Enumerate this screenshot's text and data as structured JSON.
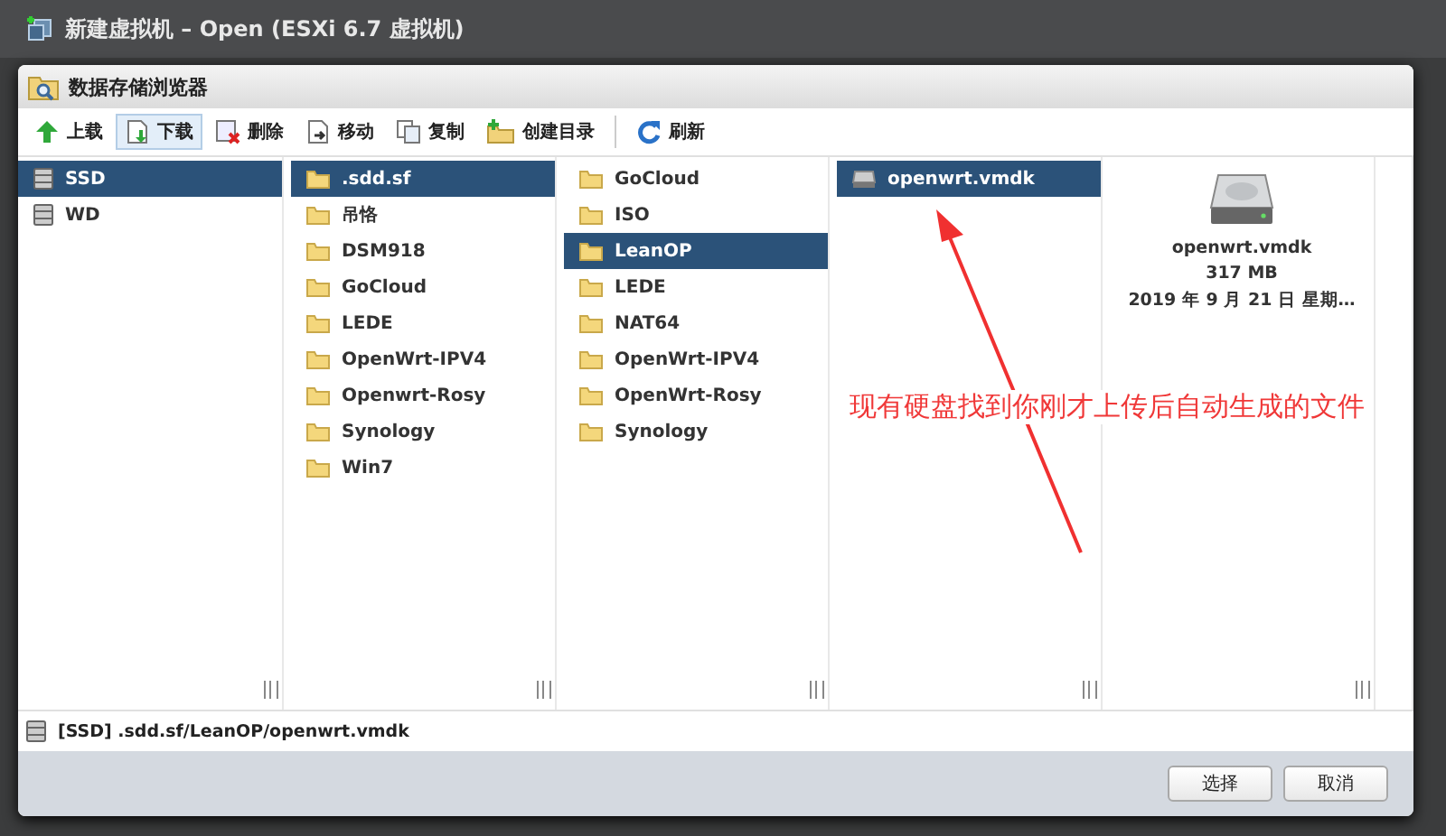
{
  "background_window": {
    "title": "新建虚拟机 – Open (ESXi 6.7 虚拟机)"
  },
  "dialog": {
    "title": "数据存储浏览器"
  },
  "toolbar": [
    {
      "kind": "upload",
      "label": "上载",
      "selected": false
    },
    {
      "kind": "download",
      "label": "下载",
      "selected": true
    },
    {
      "kind": "delete",
      "label": "删除",
      "selected": false
    },
    {
      "kind": "move",
      "label": "移动",
      "selected": false
    },
    {
      "kind": "copy",
      "label": "复制",
      "selected": false
    },
    {
      "kind": "mkdir",
      "label": "创建目录",
      "selected": false
    },
    {
      "kind": "refresh",
      "label": "刷新",
      "selected": false
    }
  ],
  "columns": [
    {
      "kind": "datastore",
      "items": [
        {
          "name": "SSD",
          "selected": true
        },
        {
          "name": "WD",
          "selected": false
        }
      ]
    },
    {
      "kind": "folder",
      "items": [
        {
          "name": ".sdd.sf",
          "selected": true
        },
        {
          "name": "吊恪",
          "selected": false
        },
        {
          "name": "DSM918",
          "selected": false
        },
        {
          "name": "GoCloud",
          "selected": false
        },
        {
          "name": "LEDE",
          "selected": false
        },
        {
          "name": "OpenWrt-IPV4",
          "selected": false
        },
        {
          "name": "Openwrt-Rosy",
          "selected": false
        },
        {
          "name": "Synology",
          "selected": false
        },
        {
          "name": "Win7",
          "selected": false
        }
      ]
    },
    {
      "kind": "folder",
      "items": [
        {
          "name": "GoCloud",
          "selected": false
        },
        {
          "name": "ISO",
          "selected": false
        },
        {
          "name": "LeanOP",
          "selected": true
        },
        {
          "name": "LEDE",
          "selected": false
        },
        {
          "name": "NAT64",
          "selected": false
        },
        {
          "name": "OpenWrt-IPV4",
          "selected": false
        },
        {
          "name": "OpenWrt-Rosy",
          "selected": false
        },
        {
          "name": "Synology",
          "selected": false
        }
      ]
    },
    {
      "kind": "file",
      "items": [
        {
          "name": "openwrt.vmdk",
          "selected": true
        }
      ]
    }
  ],
  "preview": {
    "name": "openwrt.vmdk",
    "size": "317 MB",
    "date": "2019 年 9 月 21 日 星期…"
  },
  "annotation": "现有硬盘找到你刚才上传后自动生成的文件",
  "path": "[SSD] .sdd.sf/LeanOP/openwrt.vmdk",
  "buttons": [
    "选择",
    "取消"
  ]
}
